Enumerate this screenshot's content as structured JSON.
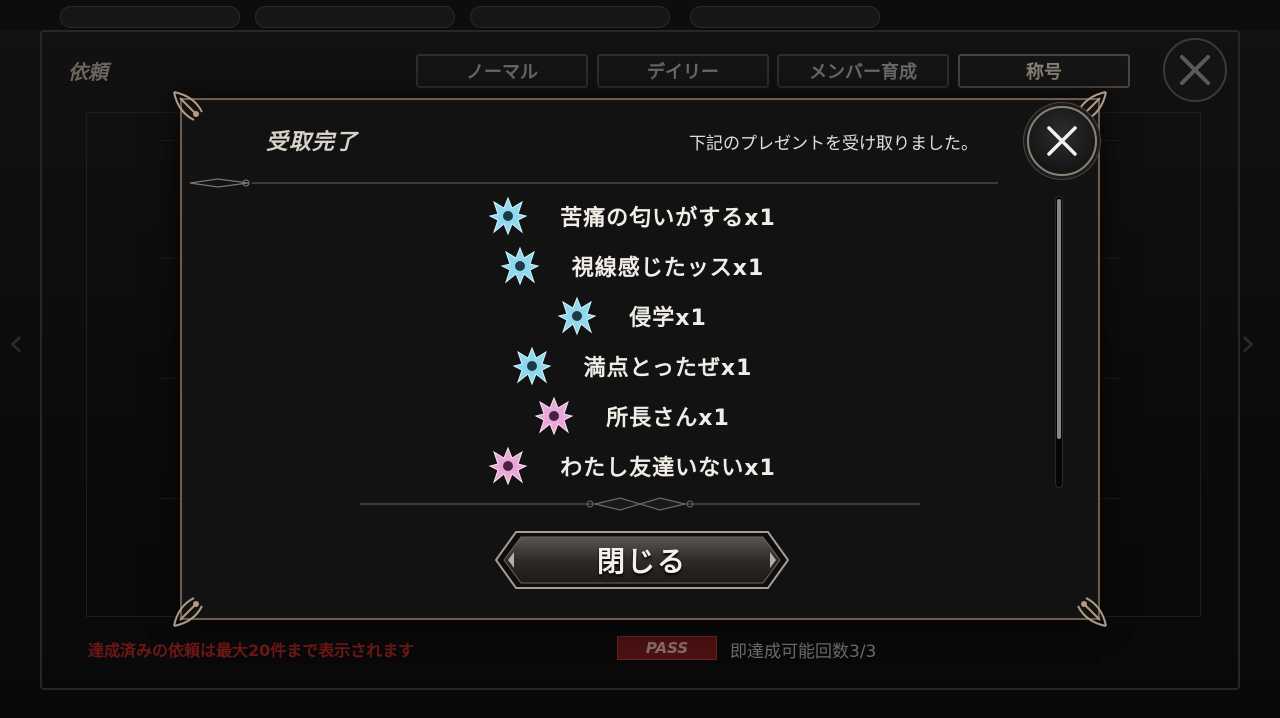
{
  "background": {
    "title": "依頼",
    "tabs": [
      {
        "label": "ノーマル",
        "active": false
      },
      {
        "label": "デイリー",
        "active": false
      },
      {
        "label": "メンバー育成",
        "active": false
      },
      {
        "label": "称号",
        "active": true
      }
    ],
    "footer_note": "達成済みの依頼は最大20件まで表示されます",
    "pass_badge": "PASS",
    "pass_text": "即達成可能回数3/3"
  },
  "modal": {
    "title": "受取完了",
    "message": "下記のプレゼントを受け取りました。",
    "close_label": "閉じる",
    "rewards": [
      {
        "label": "苦痛の匂いがするx1",
        "icon": "crest-icon-blue"
      },
      {
        "label": "視線感じたッスx1",
        "icon": "crest-icon-blue"
      },
      {
        "label": "侵学x1",
        "icon": "crest-icon-blue"
      },
      {
        "label": "満点とったぜx1",
        "icon": "crest-icon-blue"
      },
      {
        "label": "所長さんx1",
        "icon": "crest-icon-pink"
      },
      {
        "label": "わたし友達いないx1",
        "icon": "crest-icon-pink"
      }
    ]
  },
  "colors": {
    "frame": "#6f5b4c",
    "crest_blue": "#8fd8ee",
    "crest_pink": "#e9a8d8",
    "footer_note": "#6e1717"
  }
}
